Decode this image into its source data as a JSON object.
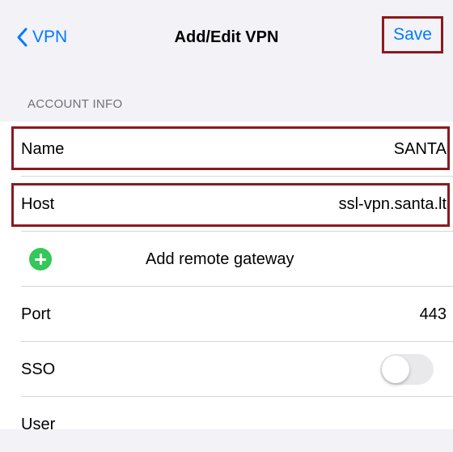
{
  "navbar": {
    "back_label": "VPN",
    "title": "Add/Edit VPN",
    "save_label": "Save"
  },
  "section": {
    "header": "ACCOUNT INFO"
  },
  "fields": {
    "name": {
      "label": "Name",
      "value": "SANTA"
    },
    "host": {
      "label": "Host",
      "value": "ssl-vpn.santa.lt"
    },
    "add_gateway": {
      "label": "Add remote gateway",
      "icon": "plus-circle-icon"
    },
    "port": {
      "label": "Port",
      "value": "443"
    },
    "sso": {
      "label": "SSO",
      "toggle_on": false
    },
    "user": {
      "label": "User"
    }
  },
  "colors": {
    "accent": "#007aff",
    "highlight_border": "#8b1a1f",
    "add_icon": "#34c759",
    "background": "#f2f2f7"
  }
}
